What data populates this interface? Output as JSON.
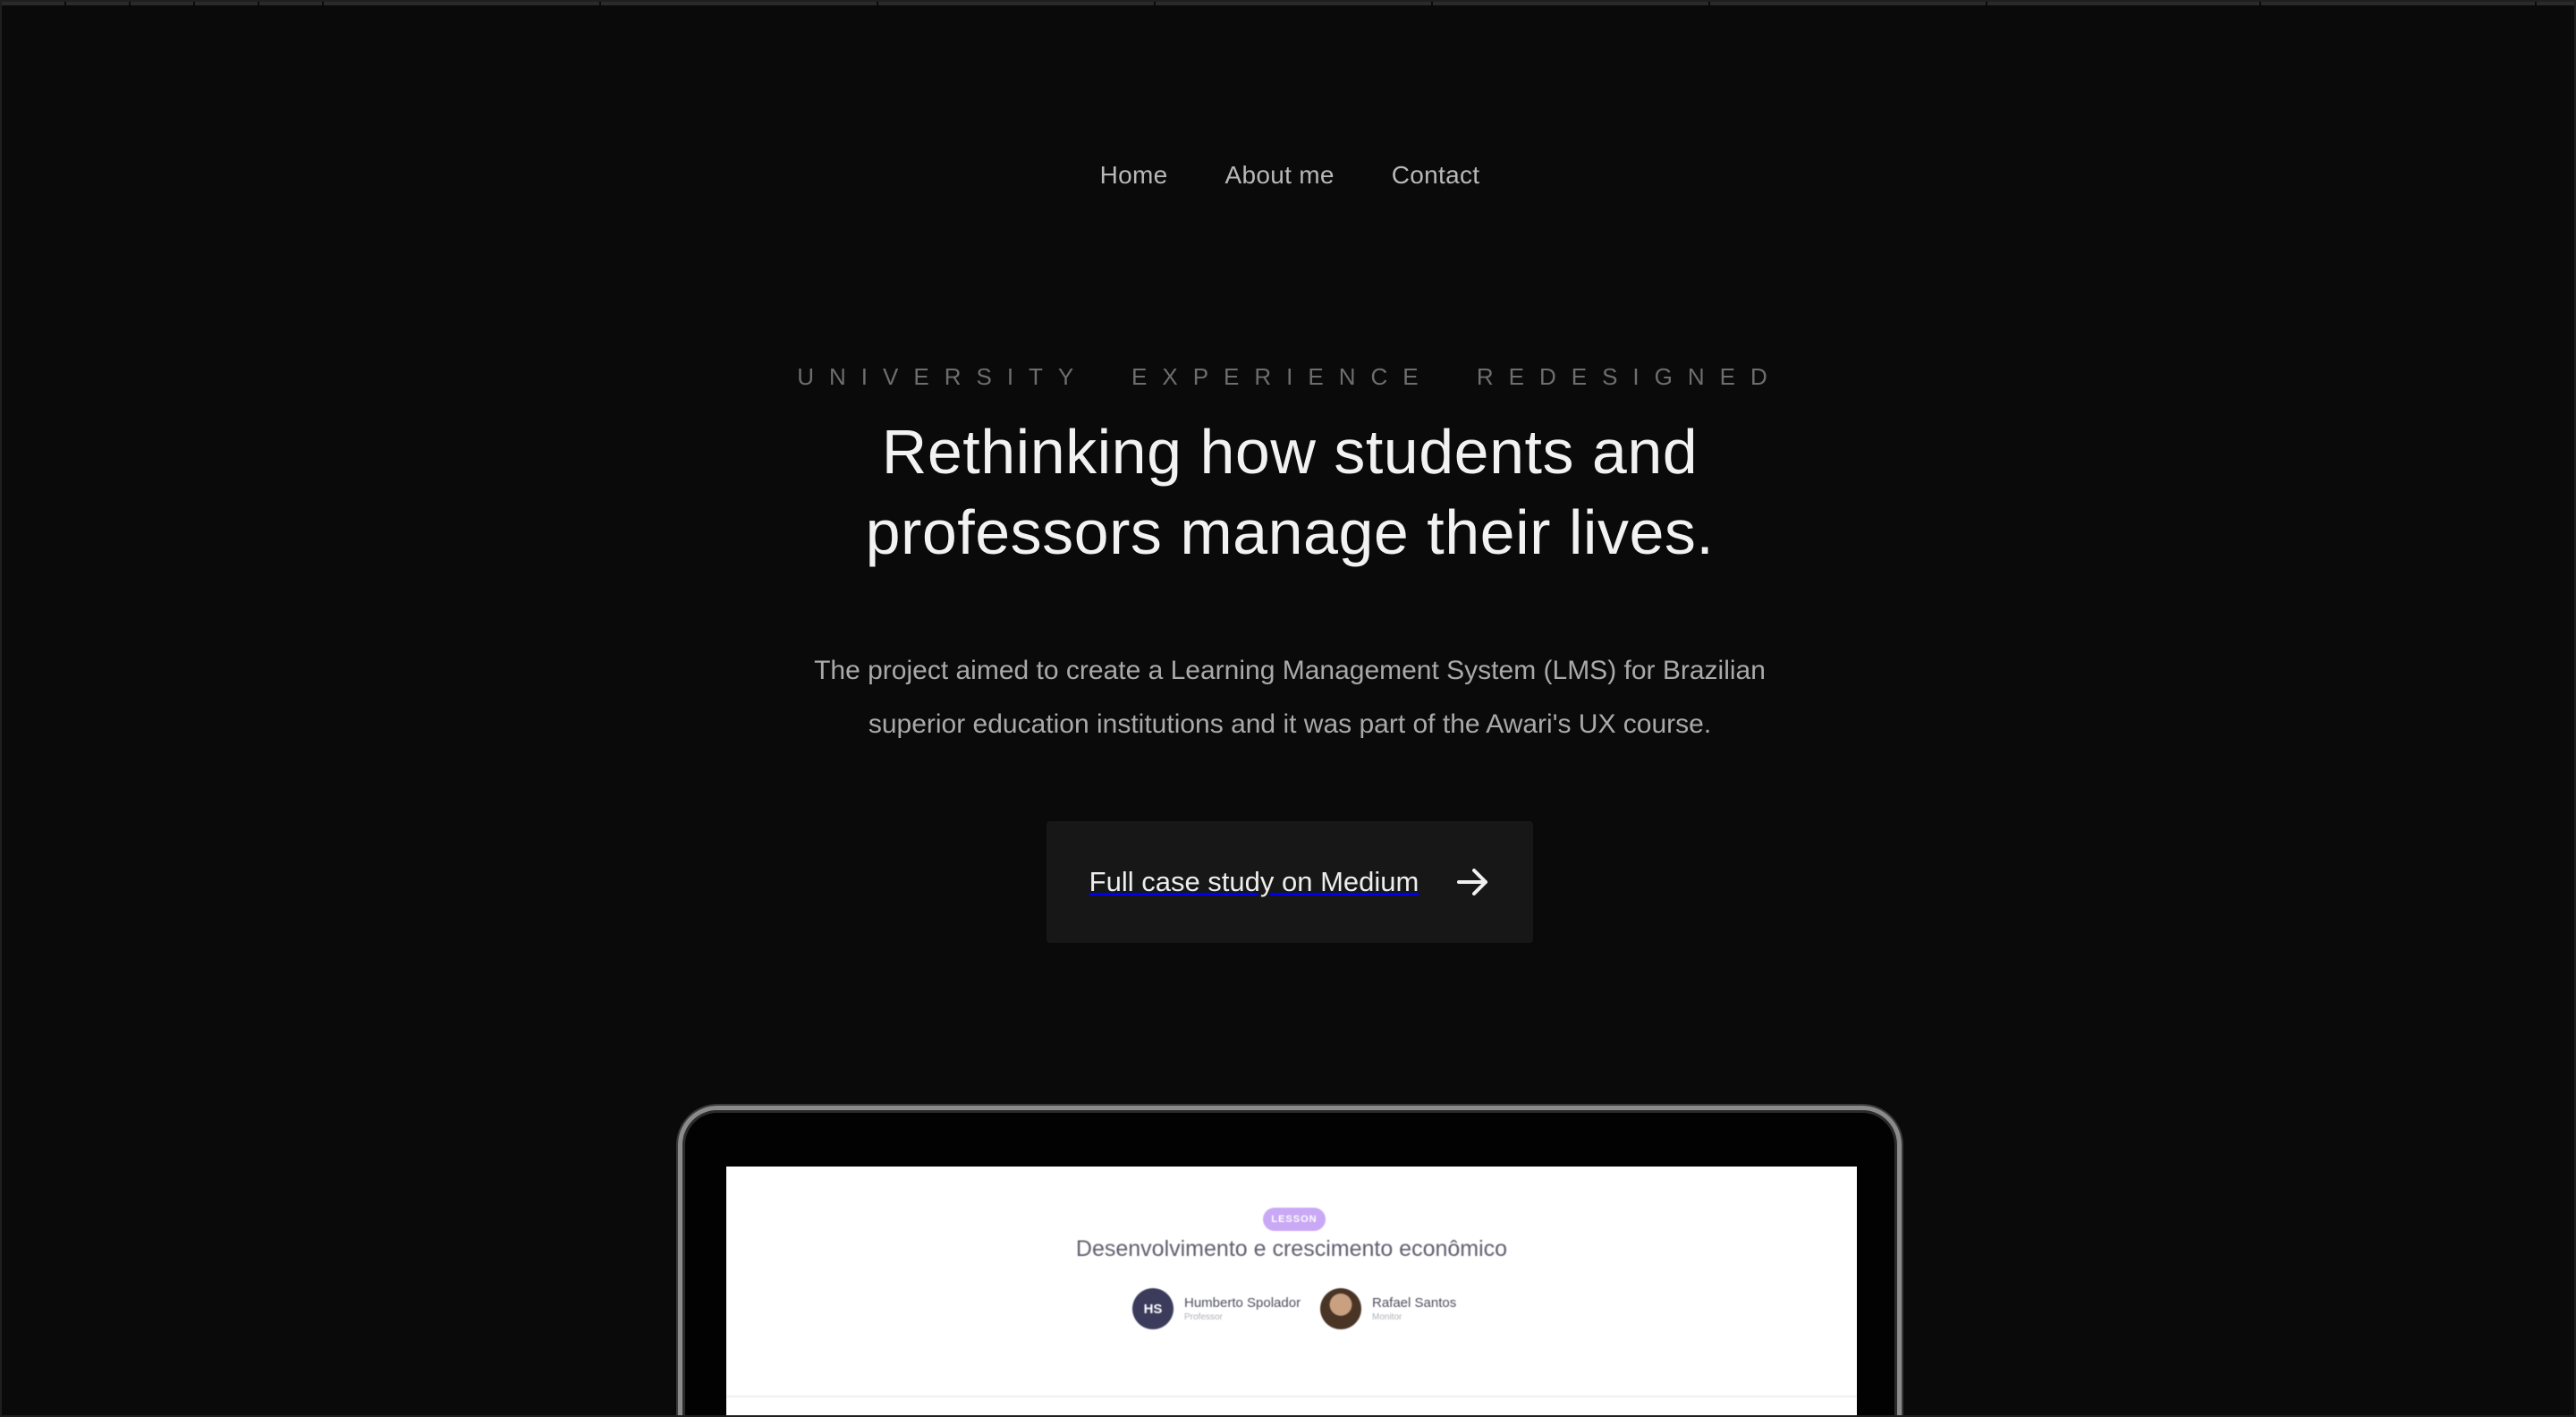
{
  "nav": {
    "items": [
      {
        "label": "Home"
      },
      {
        "label": "About me"
      },
      {
        "label": "Contact"
      }
    ]
  },
  "hero": {
    "eyebrow": "UNIVERSITY EXPERIENCE REDESIGNED",
    "headline_line1": "Rethinking how students and",
    "headline_line2": "professors manage their lives.",
    "lead_line1": "The project aimed to create a Learning Management System (LMS) for Brazilian",
    "lead_line2": "superior education institutions and it was part of the Awari's UX course.",
    "cta_label": "Full case study on Medium",
    "cta_icon": "arrow-right-icon"
  },
  "mockup": {
    "badge": "LESSON",
    "title": "Desenvolvimento e crescimento econômico",
    "people": [
      {
        "initials": "HS",
        "name": "Humberto Spolador",
        "role": "Professor"
      },
      {
        "initials": "",
        "name": "Rafael Santos",
        "role": "Monitor"
      }
    ]
  },
  "colors": {
    "background": "#0a0a0a",
    "cta_background": "#171717",
    "badge": "#c9a8f5",
    "avatar": "#3b3b5c"
  }
}
